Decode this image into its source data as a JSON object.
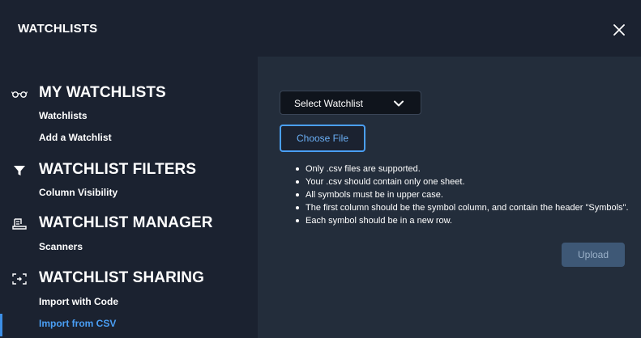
{
  "modal": {
    "title": "WATCHLISTS"
  },
  "sidebar": {
    "sections": [
      {
        "title": "MY WATCHLISTS",
        "icon": "glasses-icon",
        "items": [
          {
            "label": "Watchlists",
            "active": false
          },
          {
            "label": "Add a Watchlist",
            "active": false
          }
        ]
      },
      {
        "title": "WATCHLIST FILTERS",
        "icon": "filter-icon",
        "items": [
          {
            "label": "Column Visibility",
            "active": false
          }
        ]
      },
      {
        "title": "WATCHLIST MANAGER",
        "icon": "manager-icon",
        "items": [
          {
            "label": "Scanners",
            "active": false
          }
        ]
      },
      {
        "title": "WATCHLIST SHARING",
        "icon": "sharing-icon",
        "items": [
          {
            "label": "Import with Code",
            "active": false
          },
          {
            "label": "Import from CSV",
            "active": true
          }
        ]
      }
    ]
  },
  "main": {
    "select_watchlist": "Select Watchlist",
    "choose_file": "Choose File",
    "rules": [
      "Only .csv files are supported.",
      "Your .csv should contain only one sheet.",
      "All symbols must be in upper case.",
      "The first column should be the symbol column, and contain the header \"Symbols\".",
      "Each symbol should be in a new row."
    ],
    "upload": "Upload"
  },
  "colors": {
    "background": "#1b2230",
    "content_panel": "#232d3b",
    "accent": "#4a9ff5",
    "upload_disabled": "#3e5876"
  }
}
